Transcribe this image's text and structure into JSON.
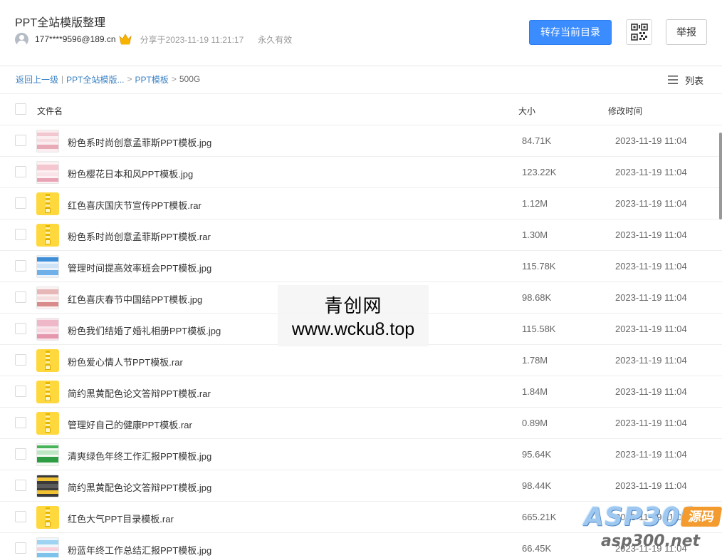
{
  "header": {
    "title": "PPT全站模版整理",
    "user": "177****9596@189.cn",
    "share_time": "分享于2023-11-19 11:21:17",
    "validity": "永久有效",
    "save_button": "转存当前目录",
    "report_button": "举报"
  },
  "breadcrumb": {
    "back": "返回上一级",
    "divider": "|",
    "level1": "PPT全站模版...",
    "sep": ">",
    "level2": "PPT模板",
    "current": "500G"
  },
  "view": {
    "label": "列表"
  },
  "table": {
    "col_name": "文件名",
    "col_size": "大小",
    "col_time": "修改时间",
    "rows": [
      {
        "name": "粉色系时尚创意孟菲斯PPT模板.jpg",
        "size": "84.71K",
        "time": "2023-11-19 11:04",
        "icon": "image-thumbnail-icon"
      },
      {
        "name": "粉色樱花日本和风PPT模板.jpg",
        "size": "123.22K",
        "time": "2023-11-19 11:04",
        "icon": "image-thumbnail-icon"
      },
      {
        "name": "红色喜庆国庆节宣传PPT模板.rar",
        "size": "1.12M",
        "time": "2023-11-19 11:04",
        "icon": "zip-file-icon"
      },
      {
        "name": "粉色系时尚创意孟菲斯PPT模板.rar",
        "size": "1.30M",
        "time": "2023-11-19 11:04",
        "icon": "zip-file-icon"
      },
      {
        "name": "管理时间提高效率班会PPT模板.jpg",
        "size": "115.78K",
        "time": "2023-11-19 11:04",
        "icon": "image-thumbnail-icon"
      },
      {
        "name": "红色喜庆春节中国结PPT模板.jpg",
        "size": "98.68K",
        "time": "2023-11-19 11:04",
        "icon": "image-thumbnail-icon"
      },
      {
        "name": "粉色我们结婚了婚礼相册PPT模板.jpg",
        "size": "115.58K",
        "time": "2023-11-19 11:04",
        "icon": "image-thumbnail-icon"
      },
      {
        "name": "粉色爱心情人节PPT模板.rar",
        "size": "1.78M",
        "time": "2023-11-19 11:04",
        "icon": "zip-file-icon"
      },
      {
        "name": "简约黑黄配色论文答辩PPT模板.rar",
        "size": "1.84M",
        "time": "2023-11-19 11:04",
        "icon": "zip-file-icon"
      },
      {
        "name": "管理好自己的健康PPT模板.rar",
        "size": "0.89M",
        "time": "2023-11-19 11:04",
        "icon": "zip-file-icon"
      },
      {
        "name": "清爽绿色年终工作汇报PPT模板.jpg",
        "size": "95.64K",
        "time": "2023-11-19 11:04",
        "icon": "image-thumbnail-icon"
      },
      {
        "name": "简约黑黄配色论文答辩PPT模板.jpg",
        "size": "98.44K",
        "time": "2023-11-19 11:04",
        "icon": "image-thumbnail-icon"
      },
      {
        "name": "红色大气PPT目录模板.rar",
        "size": "665.21K",
        "time": "2023-11-19 11:04",
        "icon": "zip-file-icon"
      },
      {
        "name": "粉蓝年终工作总结汇报PPT模板.jpg",
        "size": "66.45K",
        "time": "2023-11-19 11:04",
        "icon": "image-thumbnail-icon"
      }
    ]
  },
  "watermark": {
    "line1": "青创网",
    "line2": "www.wcku8.top"
  },
  "logo": {
    "brand": "ASP300",
    "tag": "源码",
    "url": "asp300.net"
  },
  "colors": {
    "accent": "#3b8cff",
    "link": "#3b82c4",
    "zip": "#ffd83d"
  }
}
